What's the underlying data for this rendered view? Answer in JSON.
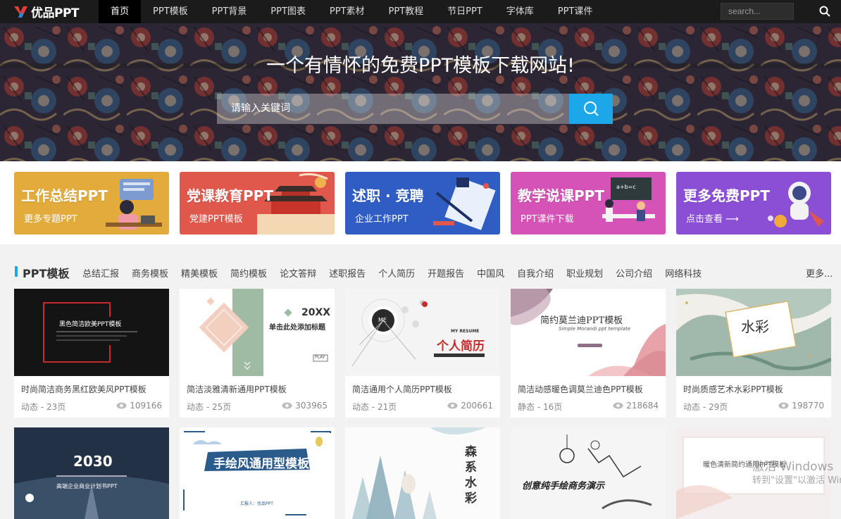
{
  "header": {
    "logo_text": "优品PPT",
    "nav": [
      "首页",
      "PPT模板",
      "PPT背景",
      "PPT图表",
      "PPT素材",
      "PPT教程",
      "节日PPT",
      "字体库",
      "PPT课件"
    ],
    "search_placeholder": "search..."
  },
  "hero": {
    "title": "一个有情怀的免费PPT模板下载网站!",
    "search_placeholder": "请输入关键词"
  },
  "banners": [
    {
      "title": "工作总结PPT",
      "sub": "更多专题PPT",
      "color": "#e2ab3c"
    },
    {
      "title": "党课教育PPT",
      "sub": "党建PPT模板",
      "color": "#e0574c"
    },
    {
      "title": "述职 · 竞聘",
      "sub": "企业工作PPT",
      "color": "#2f5dc4"
    },
    {
      "title": "教学说课PPT",
      "sub": "PPT课件下载",
      "color": "#d552b6"
    },
    {
      "title": "更多免费PPT",
      "sub": "点击查看 ⟶",
      "color": "#8b4fd6"
    }
  ],
  "section": {
    "title": "PPT模板",
    "categories": [
      "总结汇报",
      "商务模板",
      "精美模板",
      "简约模板",
      "论文答辩",
      "述职报告",
      "个人简历",
      "开题报告",
      "中国风",
      "自我介绍",
      "职业规划",
      "公司介绍",
      "网络科技"
    ],
    "more": "更多..."
  },
  "cards": [
    {
      "title": "时尚简洁商务黑红欧美风PPT模板",
      "meta": "动态 - 23页",
      "views": "109166",
      "thumb_text": "黑色简洁欧美PPT模板"
    },
    {
      "title": "简洁淡雅清新通用PPT模板",
      "meta": "动态 - 25页",
      "views": "303965",
      "thumb_text": "20XX",
      "thumb_text2": "单击此处添加标题",
      "thumb_text3": "PLAY"
    },
    {
      "title": "简洁通用个人简历PPT模板",
      "meta": "动态 - 21页",
      "views": "200661",
      "thumb_text": "个人简历",
      "thumb_text2": "MY RESUME",
      "thumb_text3": "ME"
    },
    {
      "title": "简洁动感暖色调莫兰迪色PPT模板",
      "meta": "静态 - 16页",
      "views": "218684",
      "thumb_text": "简约莫兰迪PPT模板",
      "thumb_text2": "Simple Morandi ppt template"
    },
    {
      "title": "时尚质感艺术水彩PPT模板",
      "meta": "动态 - 29页",
      "views": "198770",
      "thumb_text": "水彩"
    }
  ],
  "cards_row2": [
    {
      "thumb_text": "2030",
      "thumb_text2": "高端企业商业计划书PPT"
    },
    {
      "thumb_text": "手绘风通用型模板",
      "thumb_text2": "汇报人：优品PPT"
    },
    {
      "thumb_text": "森系水彩"
    },
    {
      "thumb_text": "创意纯手绘商务演示"
    },
    {
      "thumb_text": "暖色清新简约通用PPT模板"
    }
  ],
  "watermark": {
    "line1": "激活 Windows",
    "line2": "转到\"设置\"以激活 Windows。"
  }
}
